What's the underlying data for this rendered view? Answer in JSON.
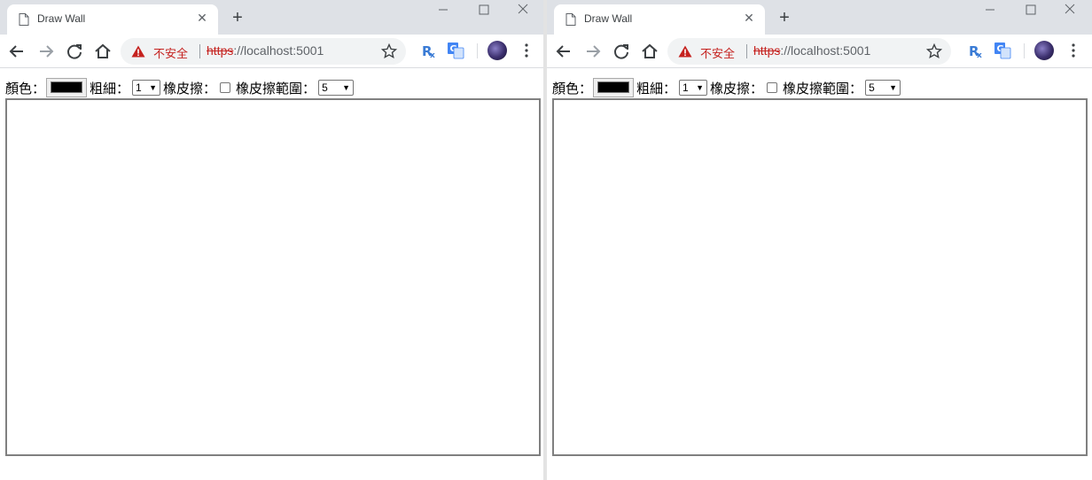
{
  "windows": [
    {
      "tab": {
        "title": "Draw Wall"
      },
      "address": {
        "security_label": "不安全",
        "scheme": "https",
        "rest": "://localhost:5001"
      },
      "controls": {
        "color_label": "顏色：",
        "color_value": "#000000",
        "width_label": "粗細：",
        "width_selected": "1",
        "eraser_label": "橡皮擦：",
        "eraser_checked": false,
        "eraser_range_label": "橡皮擦範圍：",
        "eraser_range_selected": "5"
      }
    },
    {
      "tab": {
        "title": "Draw Wall"
      },
      "address": {
        "security_label": "不安全",
        "scheme": "https",
        "rest": "://localhost:5001"
      },
      "controls": {
        "color_label": "顏色：",
        "color_value": "#000000",
        "width_label": "粗細：",
        "width_selected": "1",
        "eraser_label": "橡皮擦：",
        "eraser_checked": false,
        "eraser_range_label": "橡皮擦範圍：",
        "eraser_range_selected": "5"
      }
    }
  ],
  "icons": {
    "tab": "document-icon",
    "close": "close-icon",
    "new_tab": "plus-icon",
    "back": "back-arrow-icon",
    "forward": "forward-arrow-icon",
    "reload": "reload-icon",
    "home": "home-icon",
    "warning": "warning-icon",
    "bookmark": "star-icon",
    "extension_rx": "rx-extension-icon",
    "extension_translate": "translate-icon",
    "profile": "avatar",
    "menu": "kebab-menu-icon"
  },
  "colors": {
    "titlebar": "#dee1e6",
    "insecure": "#c5221f",
    "canvas_border": "#808080"
  }
}
